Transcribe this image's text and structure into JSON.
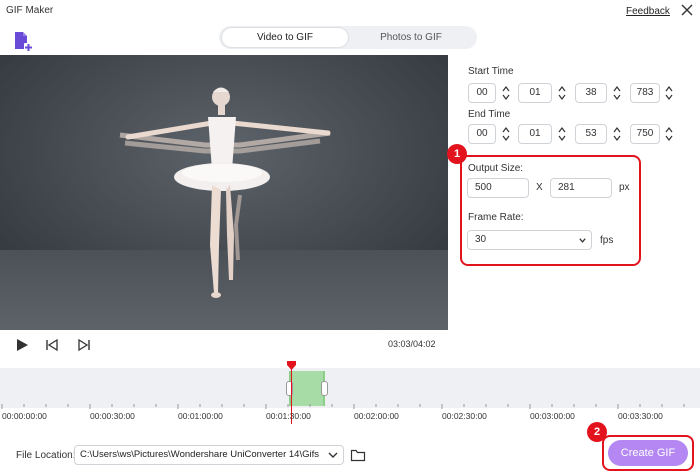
{
  "window": {
    "title": "GIF Maker",
    "feedback_label": "Feedback"
  },
  "tabs": [
    {
      "label": "Video to GIF",
      "active": true
    },
    {
      "label": "Photos to GIF",
      "active": false
    }
  ],
  "player": {
    "timecode": "03:03/04:02"
  },
  "settings": {
    "start_time": {
      "label": "Start Time",
      "hh": "00",
      "mm": "01",
      "ss": "38",
      "ms": "783"
    },
    "end_time": {
      "label": "End Time",
      "hh": "00",
      "mm": "01",
      "ss": "53",
      "ms": "750"
    },
    "output_size": {
      "label": "Output Size:",
      "width": "500",
      "separator": "X",
      "height": "281",
      "unit": "px"
    },
    "frame_rate": {
      "label": "Frame Rate:",
      "value": "30",
      "unit": "fps"
    }
  },
  "timeline": {
    "ticks": [
      "00:00:00:00",
      "00:00:30:00",
      "00:01:00:00",
      "00:01:30:00",
      "00:02:00:00",
      "00:02:30:00",
      "00:03:00:00",
      "00:03:30:00"
    ]
  },
  "footer": {
    "file_location_label": "File Location:",
    "file_path": "C:\\Users\\ws\\Pictures\\Wondershare UniConverter 14\\Gifs",
    "create_label": "Create GIF"
  },
  "annotations": {
    "badge1": "1",
    "badge2": "2"
  },
  "colors": {
    "accent": "#b487f3",
    "highlight_red": "#e3131e",
    "selection_green": "#a8dca6"
  },
  "icons": [
    "add-file-icon",
    "close-icon",
    "play-icon",
    "previous-frame-icon",
    "next-frame-icon",
    "spin-arrows-icon",
    "chevron-down-icon",
    "folder-icon",
    "playhead-marker-icon"
  ]
}
